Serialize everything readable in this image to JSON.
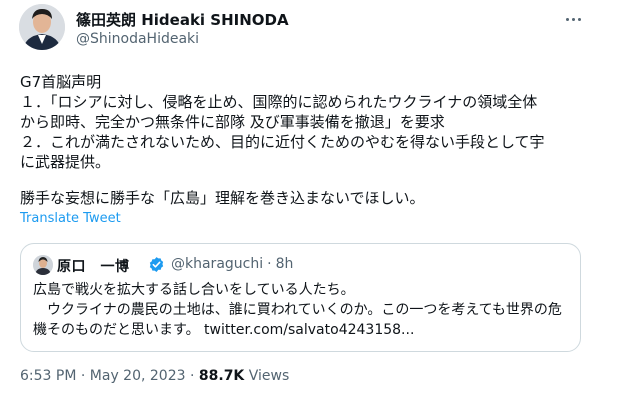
{
  "author": {
    "name": "篠田英朗 Hideaki SHINODA",
    "handle": "@ShinodaHideaki"
  },
  "tweet": {
    "lines": [
      "G7首脳声明",
      "１．「ロシアに対し、侵略を止め、国際的に認められたウクライナの領域全体",
      "から即時、完全かつ無条件に部隊 及び軍事装備を撤退」を要求",
      "２．これが満たされないため、目的に近付くためのやむを得ない手段として宇",
      "に武器提供。",
      "",
      "勝手な妄想に勝手な「広島」理解を巻き込まないでほしい。"
    ],
    "translate_label": "Translate Tweet"
  },
  "quote": {
    "name": "原口　一博",
    "handle": "@kharaguchi",
    "separator": "·",
    "time": "8h",
    "lines": [
      "広島で戦火を拡大する話し合いをしている人たち。",
      "　ウクライナの農民の土地は、誰に買われていくのか。この一つを考えても世界の危",
      "機そのものだと思います。 twitter.com/salvato4243158..."
    ],
    "verified_color": "#1d9bf0"
  },
  "meta": {
    "time": "6:53 PM",
    "date": "May 20, 2023",
    "separator": "·",
    "views_count": "88.7K",
    "views_label": "Views"
  },
  "colors": {
    "text": "#0f1419",
    "secondary": "#536471",
    "link": "#1d9bf0",
    "border": "#cfd9de"
  }
}
